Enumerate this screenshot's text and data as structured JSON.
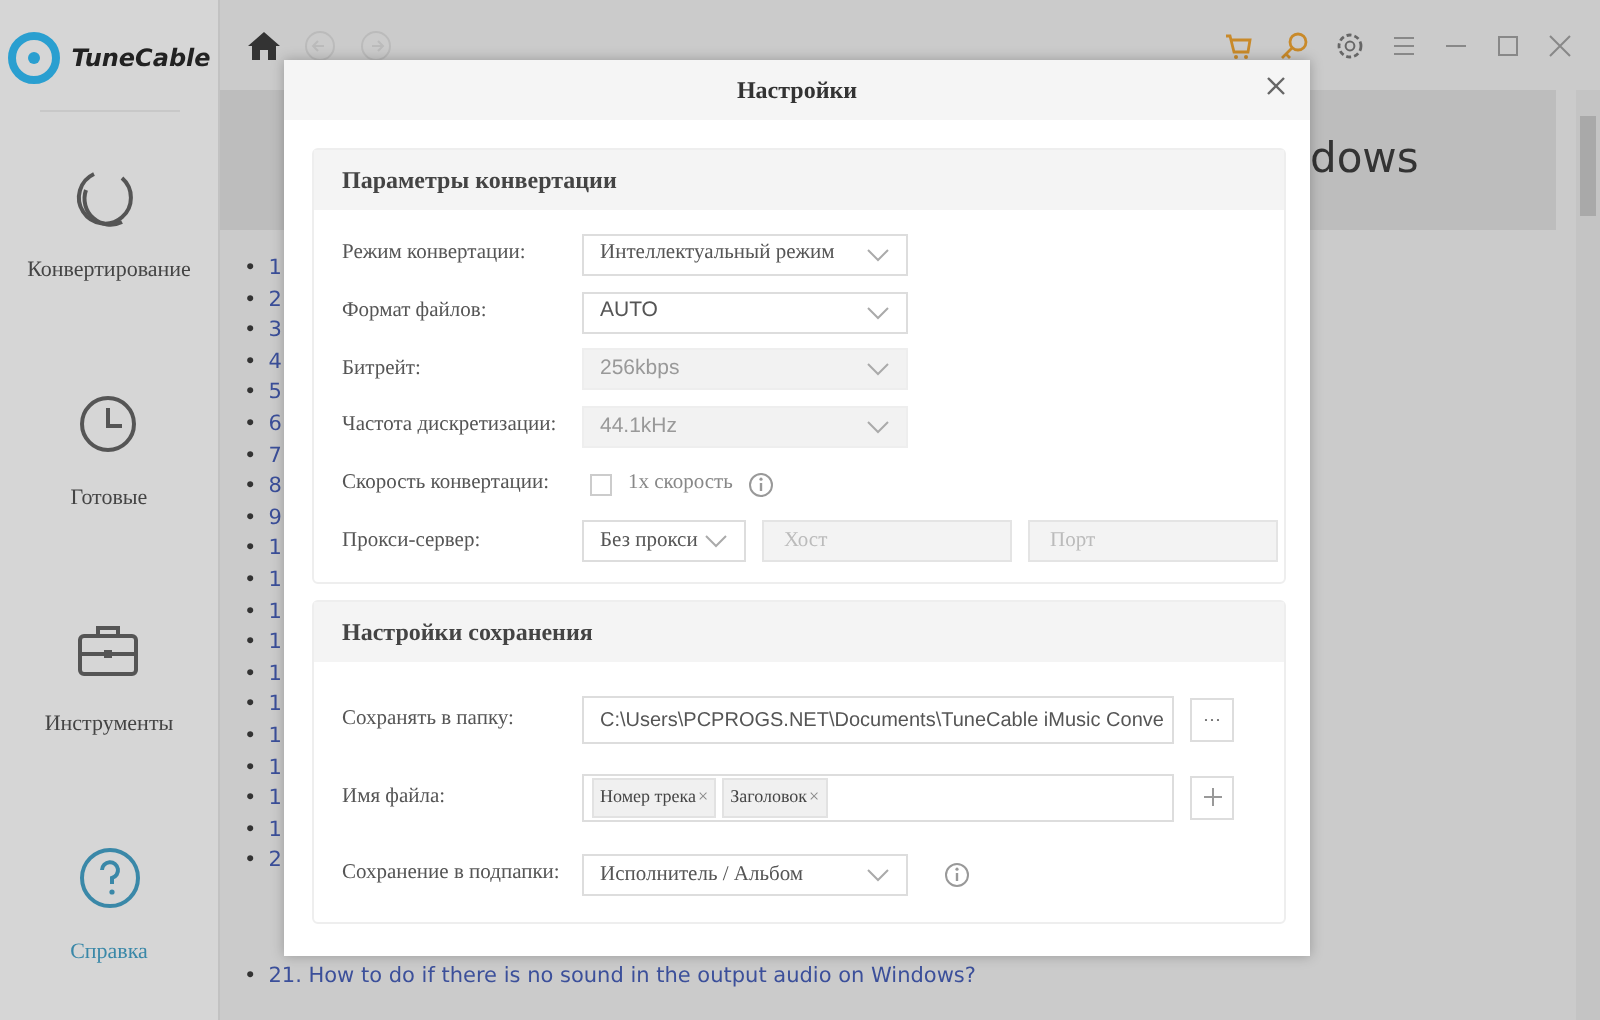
{
  "app": {
    "logo": "TuneCable"
  },
  "sidebar": {
    "items": [
      {
        "label": "Конвертирование",
        "kind": "convert",
        "selected": false
      },
      {
        "label": "Готовые",
        "kind": "clock",
        "selected": false
      },
      {
        "label": "Инструменты",
        "kind": "toolbox",
        "selected": false
      },
      {
        "label": "Справка",
        "kind": "help",
        "selected": true
      }
    ]
  },
  "background_page": {
    "heading": "dows",
    "bullet": "•",
    "list_items": [
      "1",
      "2",
      "3",
      "4",
      "5",
      "6",
      "7",
      "8",
      "9",
      "1",
      "1",
      "1",
      "1",
      "1",
      "1",
      "1",
      "1",
      "1",
      "1",
      "2"
    ],
    "last_item": "21. How to do if there is no sound in the output audio on Windows?"
  },
  "dialog": {
    "title": "Настройки",
    "sections": [
      {
        "title": "Параметры конвертации",
        "rows": [
          {
            "kind": "select",
            "label": "Режим конвертации:",
            "value": "Интеллектуальный режим",
            "disabled": false
          },
          {
            "kind": "select",
            "label": "Формат файлов:",
            "value": "AUTO",
            "disabled": false
          },
          {
            "kind": "select",
            "label": "Битрейт:",
            "value": "256kbps",
            "disabled": true
          },
          {
            "kind": "select",
            "label": "Частота дискретизации:",
            "value": "44.1kHz",
            "disabled": true
          },
          {
            "kind": "checkbox",
            "label": "Скорость конвертации:",
            "option": "1x скорость",
            "checked": false,
            "info": true
          },
          {
            "kind": "proxy",
            "label": "Прокси-сервер:",
            "value": "Без прокси",
            "host_placeholder": "Хост",
            "port_placeholder": "Порт"
          }
        ]
      },
      {
        "title": "Настройки сохранения",
        "rows": [
          {
            "kind": "path",
            "label": "Сохранять в папку:",
            "value": "C:\\Users\\PCPROGS.NET\\Documents\\TuneCable iMusic Conve",
            "button": "···"
          },
          {
            "kind": "tags",
            "label": "Имя файла:",
            "tags": [
              {
                "label": "Номер трека",
                "remove": "×"
              },
              {
                "label": "Заголовок",
                "remove": "×"
              }
            ]
          },
          {
            "kind": "select",
            "label": "Сохранение в подпапки:",
            "value": "Исполнитель / Альбом",
            "disabled": false,
            "info": true
          }
        ]
      }
    ]
  }
}
